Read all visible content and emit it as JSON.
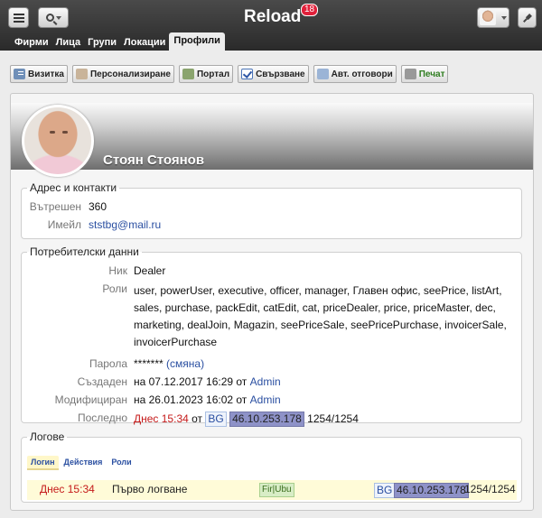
{
  "app": {
    "title": "Reload",
    "badge": "18"
  },
  "tabs": [
    "Фирми",
    "Лица",
    "Групи",
    "Локации",
    "Профили"
  ],
  "toolbar": {
    "vcard": "Визитка",
    "personalize": "Персонализиране",
    "portal": "Портал",
    "link": "Свързване",
    "auto_reply": "Авт. отговори",
    "print": "Печат"
  },
  "profile": {
    "name": "Стоян Стоянов"
  },
  "contacts": {
    "legend": "Адрес и контакти",
    "internal_label": "Вътрешен",
    "internal_value": "360",
    "email_label": "Имейл",
    "email_value": "ststbg@mail.ru"
  },
  "user_data": {
    "legend": "Потребителски данни",
    "nick_label": "Ник",
    "nick_value": "Dealer",
    "roles_label": "Роли",
    "roles_lines": [
      "user, powerUser, executive, officer, manager, Главен офис, seePrice, listArt,",
      "sales, purchase, packEdit, catEdit, cat, priceDealer, price, priceMaster, dec,",
      "marketing, dealJoin, Magazin, seePriceSale, seePricePurchase, invoicerSale,",
      "invoicerPurchase"
    ],
    "password_label": "Парола",
    "password_value": "*******",
    "password_change": "(смяна)",
    "created_label": "Създаден",
    "created_prefix": "на 07.12.2017 16:29 от",
    "created_by": "Admin",
    "modified_label": "Модифициран",
    "modified_prefix": "на 26.01.2023 16:02 от",
    "modified_by": "Admin",
    "last_label": "Последно",
    "last_time": "Днес 15:34",
    "last_from": "от",
    "last_country": "BG",
    "last_ip": "46.10.253.178",
    "last_res": "1254/1254"
  },
  "logs": {
    "legend": "Логове",
    "tabs": [
      "Логин",
      "Действия",
      "Роли"
    ],
    "row": {
      "time": "Днес 15:34",
      "event": "Първо логване",
      "os": "Fir|Ubu",
      "country": "BG",
      "ip": "46.10.253.178",
      "res": "1254/1254"
    }
  },
  "colors": {
    "accent": "#2a4fa1",
    "alert": "#c51a1a",
    "ip": "#8e92c8",
    "badge": "#e0203a"
  }
}
